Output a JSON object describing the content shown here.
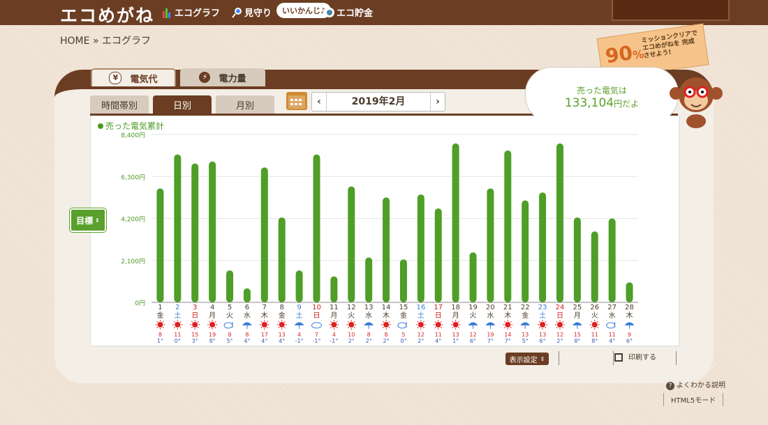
{
  "app": {
    "logo": "エコめがね",
    "nav": [
      {
        "label": "エコグラフ",
        "icon": "bar-chart-icon"
      },
      {
        "label": "見守り",
        "icon": "magnifier-icon"
      },
      {
        "label": "エコ貯金",
        "icon": "coin-icon"
      }
    ],
    "pill": "いいかんじ♪"
  },
  "breadcrumb": {
    "home": "HOME",
    "sep": "»",
    "current": "エコグラフ"
  },
  "mission": {
    "percent": "90",
    "unit": "%",
    "text": "ミッションクリアで エコめがねを 完成させよう!"
  },
  "tabs": [
    {
      "label": "電気代",
      "icon": "yen-icon",
      "active": true
    },
    {
      "label": "電力量",
      "icon": "lightning-icon",
      "active": false
    }
  ],
  "subtabs": [
    {
      "label": "時間帯別",
      "active": false
    },
    {
      "label": "日別",
      "active": true
    },
    {
      "label": "月別",
      "active": false
    }
  ],
  "month_nav": {
    "prev": "‹",
    "label": "2019年2月",
    "next": "›"
  },
  "bubble": {
    "line1": "売った電気は",
    "amount": "133,104",
    "suffix": "円だよ"
  },
  "goal_button": "目標",
  "buttons": {
    "display_settings": "表示設定",
    "print": "印刷する",
    "help": "よくわかる説明",
    "html5": "HTML5モード"
  },
  "colors": {
    "bar": "#4e9e27",
    "brown": "#6b3d22",
    "sat": "#3a7bd5",
    "sun": "#cc2020"
  },
  "chart_data": {
    "type": "bar",
    "series": [
      {
        "name": "売った電気累計"
      }
    ],
    "yticks": [
      "8,400円",
      "6,300円",
      "4,200円",
      "2,100円",
      "0円"
    ],
    "ylim": [
      0,
      8400
    ],
    "categories": [
      "1",
      "2",
      "3",
      "4",
      "5",
      "6",
      "7",
      "8",
      "9",
      "10",
      "11",
      "12",
      "13",
      "14",
      "15",
      "16",
      "17",
      "18",
      "19",
      "20",
      "21",
      "22",
      "23",
      "24",
      "25",
      "26",
      "27",
      "28"
    ],
    "weekdays": [
      "金",
      "土",
      "日",
      "月",
      "火",
      "水",
      "木",
      "金",
      "土",
      "日",
      "月",
      "火",
      "水",
      "木",
      "金",
      "土",
      "日",
      "月",
      "火",
      "水",
      "木",
      "金",
      "土",
      "日",
      "月",
      "火",
      "水",
      "木"
    ],
    "values": [
      5700,
      7400,
      6950,
      7050,
      1600,
      700,
      6750,
      4250,
      1600,
      7400,
      1300,
      5800,
      2250,
      5250,
      2150,
      5400,
      4700,
      7950,
      2500,
      5700,
      7600,
      5100,
      5500,
      7950,
      4250,
      3550,
      4200,
      1000
    ],
    "weather": [
      "sun",
      "sun",
      "sun",
      "sun",
      "cloud-rain",
      "rain",
      "sun",
      "sun",
      "rain",
      "cloud",
      "sun",
      "sun",
      "rain",
      "sun",
      "cloud-rain",
      "sun",
      "sun",
      "sun",
      "rain",
      "rain",
      "sun",
      "rain",
      "sun",
      "sun",
      "rain",
      "sun",
      "cloud-rain",
      "rain"
    ],
    "high": [
      "8",
      "11",
      "15",
      "19",
      "8",
      "8",
      "17",
      "13",
      "4",
      "7",
      "4",
      "10",
      "8",
      "8",
      "5",
      "12",
      "11",
      "13",
      "12",
      "19",
      "14",
      "13",
      "13",
      "12",
      "15",
      "11",
      "11",
      "9"
    ],
    "low": [
      "1",
      "0",
      "3",
      "8",
      "5",
      "4",
      "4",
      "4",
      "-1",
      "-1",
      "-1",
      "2",
      "2",
      "2",
      "0",
      "2",
      "4",
      "1",
      "6",
      "7",
      "7",
      "5",
      "6",
      "2",
      "8",
      "8",
      "4",
      "6"
    ]
  }
}
